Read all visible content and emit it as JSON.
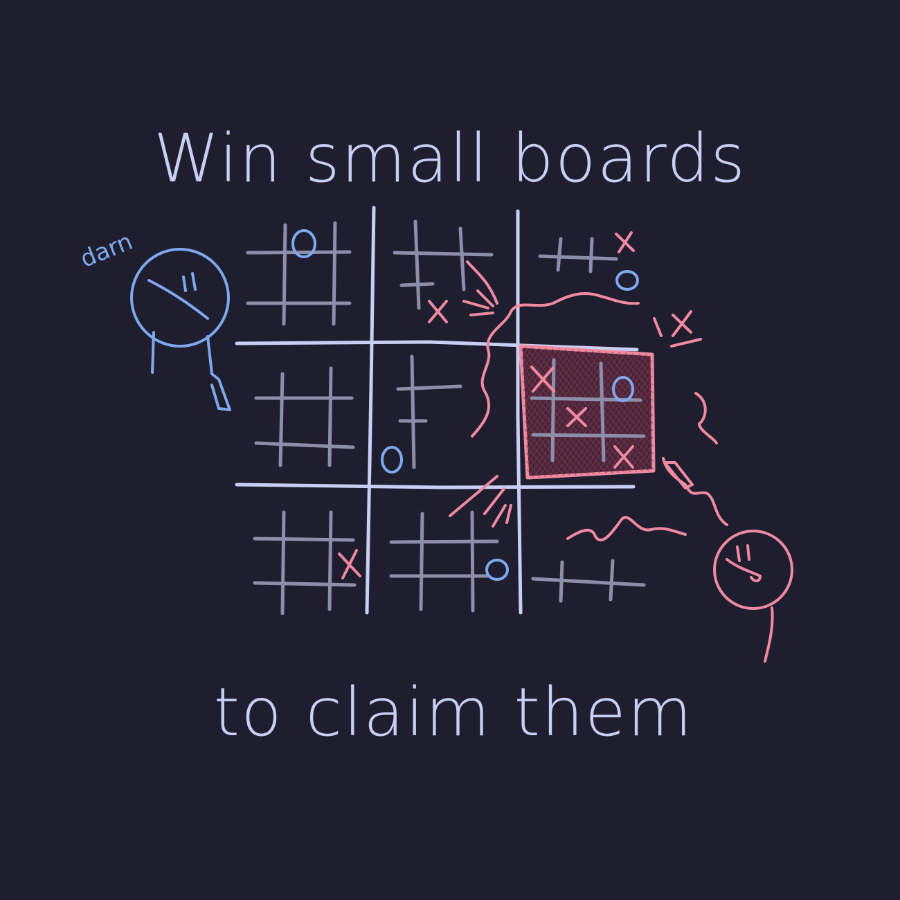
{
  "headline": {
    "top": "Win small boards",
    "bottom": "to claim them"
  },
  "caption_blue": "darn",
  "colors": {
    "background": "#1f1e2e",
    "big_grid": "#c9cff2",
    "small_grid": "#8d8fa8",
    "player_x": "#f08aa0",
    "player_o": "#7fa9ee",
    "claimed_fill": "#5a2b40"
  },
  "board": {
    "claimed_board": "middle-right",
    "claimed_by": "X",
    "small_boards": [
      {
        "name": "top-left",
        "marks": [
          "O"
        ]
      },
      {
        "name": "top-middle",
        "marks": [
          "X"
        ]
      },
      {
        "name": "top-right",
        "marks": [
          "X",
          "O"
        ]
      },
      {
        "name": "middle-left",
        "marks": []
      },
      {
        "name": "center",
        "marks": [
          "O"
        ]
      },
      {
        "name": "middle-right",
        "marks": [
          "X",
          "X",
          "O",
          "X"
        ]
      },
      {
        "name": "bottom-left",
        "marks": [
          "X"
        ]
      },
      {
        "name": "bottom-middle",
        "marks": [
          "O"
        ]
      },
      {
        "name": "bottom-right",
        "marks": []
      }
    ]
  },
  "characters": [
    {
      "player": "O",
      "mood": "sad",
      "icon": "blue-stick-figure"
    },
    {
      "player": "X",
      "mood": "triumphant",
      "icon": "pink-stick-figure"
    }
  ]
}
